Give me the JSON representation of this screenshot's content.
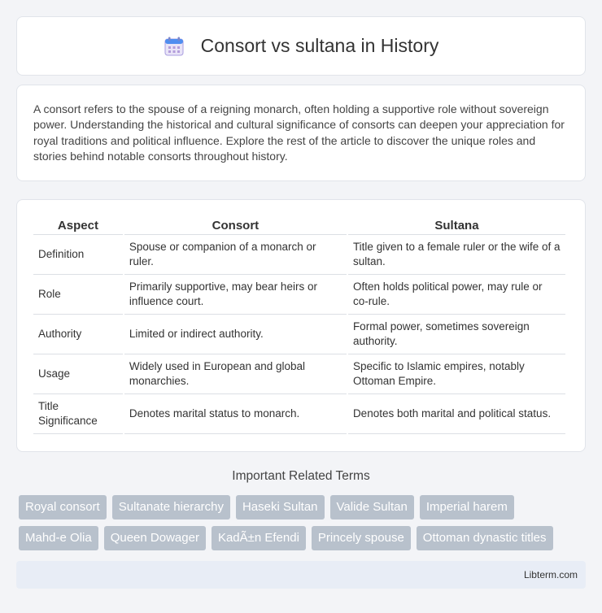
{
  "header": {
    "title": "Consort vs sultana in History",
    "icon": "calendar-icon"
  },
  "intro": {
    "text": "A consort refers to the spouse of a reigning monarch, often holding a supportive role without sovereign power. Understanding the historical and cultural significance of consorts can deepen your appreciation for royal traditions and political influence. Explore the rest of the article to discover the unique roles and stories behind notable consorts throughout history."
  },
  "table": {
    "headers": [
      "Aspect",
      "Consort",
      "Sultana"
    ],
    "rows": [
      [
        "Definition",
        "Spouse or companion of a monarch or ruler.",
        "Title given to a female ruler or the wife of a sultan."
      ],
      [
        "Role",
        "Primarily supportive, may bear heirs or influence court.",
        "Often holds political power, may rule or co-rule."
      ],
      [
        "Authority",
        "Limited or indirect authority.",
        "Formal power, sometimes sovereign authority."
      ],
      [
        "Usage",
        "Widely used in European and global monarchies.",
        "Specific to Islamic empires, notably Ottoman Empire."
      ],
      [
        "Title Significance",
        "Denotes marital status to monarch.",
        "Denotes both marital and political status."
      ]
    ]
  },
  "related": {
    "title": "Important Related Terms",
    "row1": [
      "Royal consort",
      "Sultanate hierarchy",
      "Haseki Sultan",
      "Valide Sultan",
      "Imperial harem"
    ],
    "row2": [
      "Mahd-e Olia",
      "Queen Dowager",
      "KadÃ±n Efendi",
      "Princely spouse",
      "Ottoman dynastic titles"
    ]
  },
  "footer": {
    "site": "Libterm.com"
  }
}
